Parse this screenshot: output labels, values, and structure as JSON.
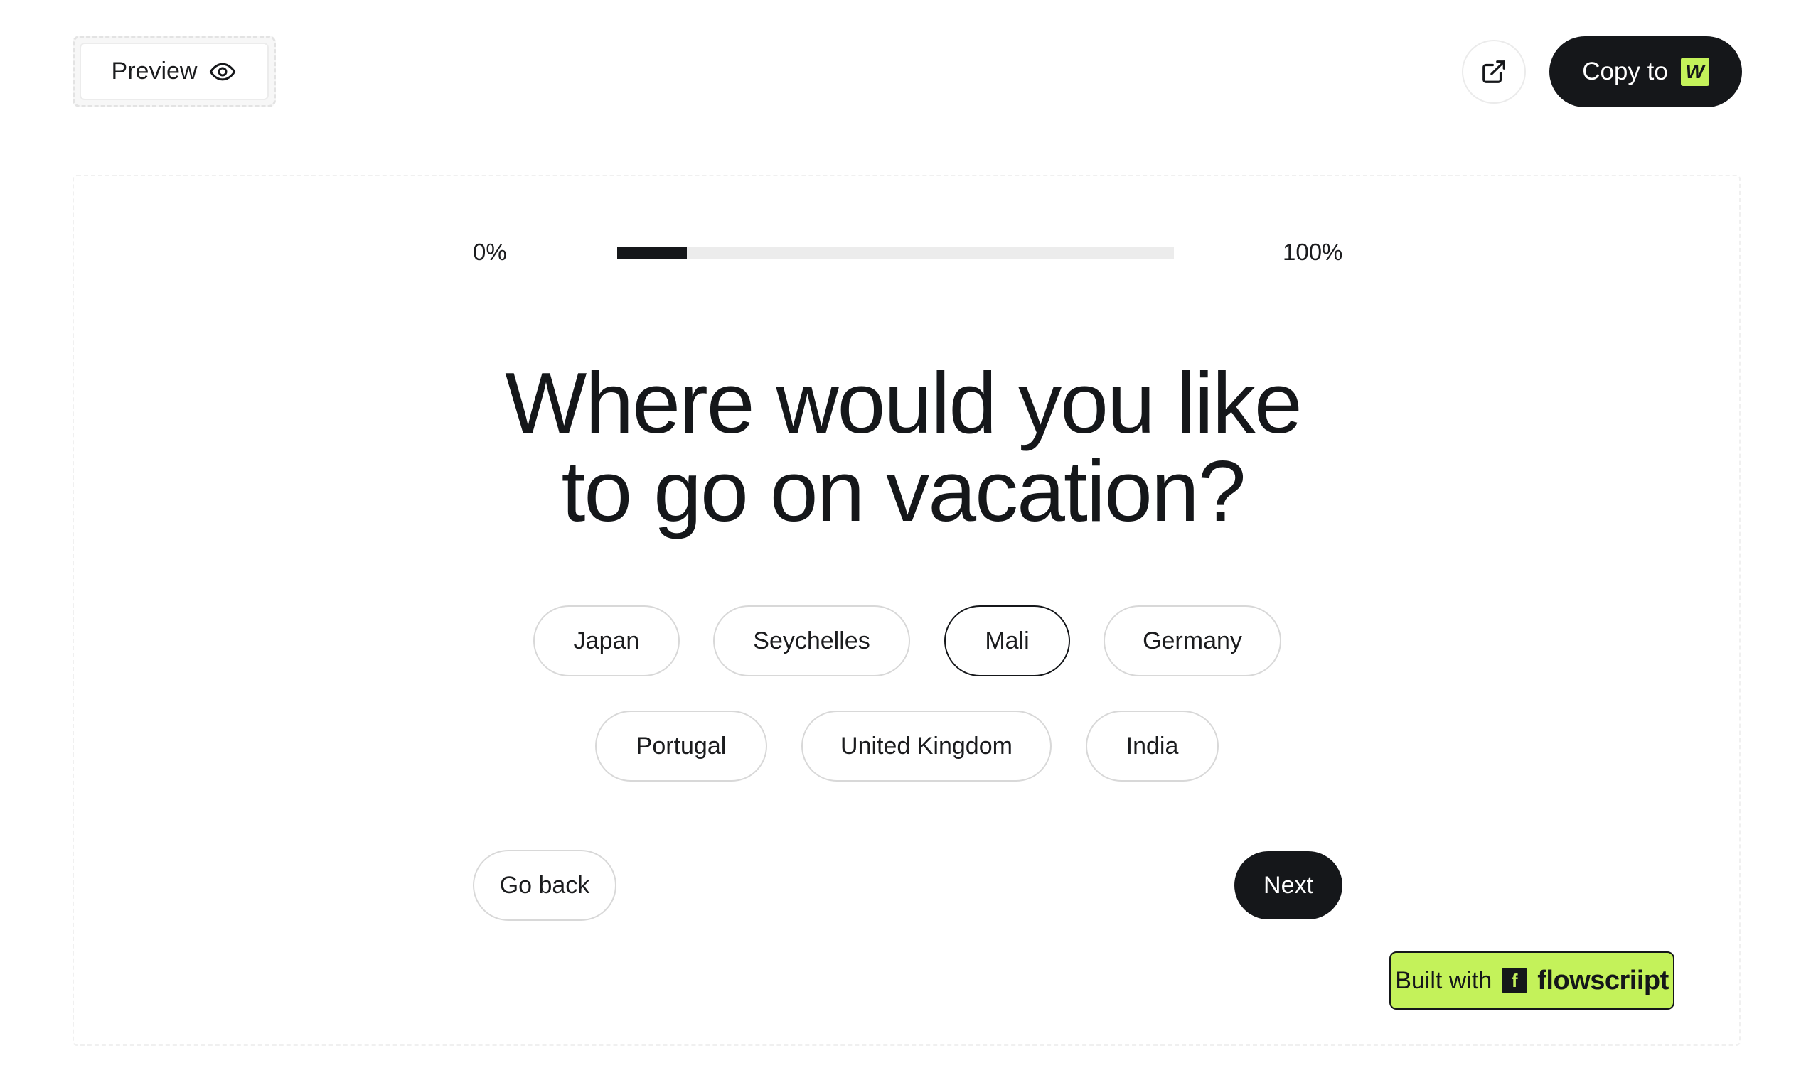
{
  "header": {
    "preview_label": "Preview",
    "copy_label": "Copy to",
    "copy_logo": "W"
  },
  "progress": {
    "start_label": "0%",
    "end_label": "100%",
    "value_percent": 12.5
  },
  "question": {
    "line1": "Where would you like",
    "line2": "to go on vacation?"
  },
  "options": [
    {
      "label": "Japan",
      "selected": false
    },
    {
      "label": "Seychelles",
      "selected": false
    },
    {
      "label": "Mali",
      "selected": true
    },
    {
      "label": "Germany",
      "selected": false
    },
    {
      "label": "Portugal",
      "selected": false
    },
    {
      "label": "United Kingdom",
      "selected": false
    },
    {
      "label": "India",
      "selected": false
    }
  ],
  "nav": {
    "back_label": "Go back",
    "next_label": "Next"
  },
  "badge": {
    "prefix": "Built with",
    "logo": "f",
    "brand": "flowscriipt"
  },
  "colors": {
    "accent": "#c4f25a",
    "dark": "#15171a"
  }
}
